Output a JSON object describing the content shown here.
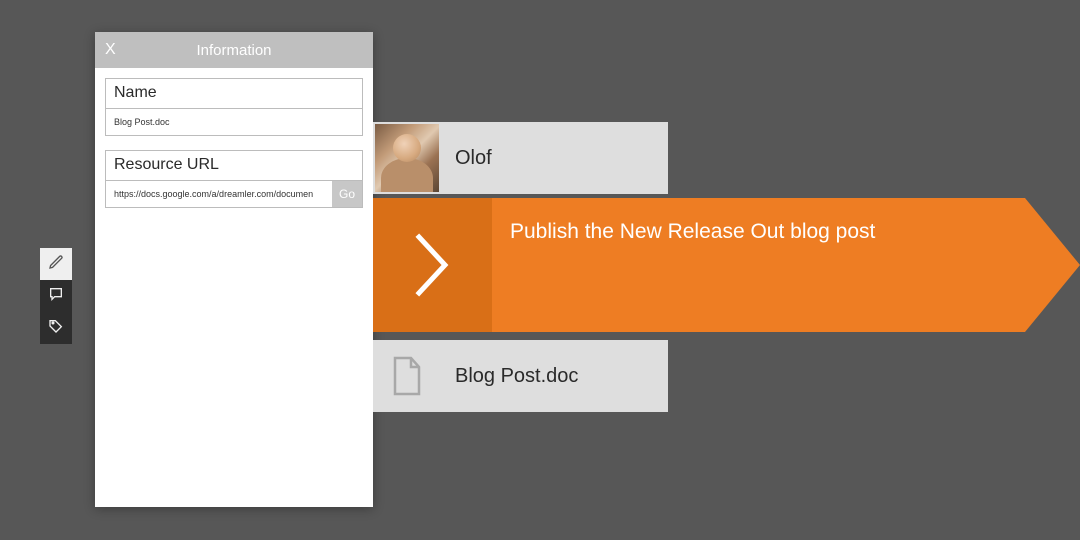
{
  "toolstrip": {
    "edit_icon": "pencil-icon",
    "comment_icon": "comment-icon",
    "tag_icon": "tag-icon"
  },
  "info_panel": {
    "close_label": "X",
    "title": "Information",
    "name": {
      "label": "Name",
      "value": "Blog Post.doc"
    },
    "resource_url": {
      "label": "Resource URL",
      "value": "https://docs.google.com/a/dreamler.com/documen",
      "go_label": "Go"
    }
  },
  "user_card": {
    "name": "Olof"
  },
  "task": {
    "title": "Publish the New Release Out blog post"
  },
  "file_card": {
    "name": "Blog Post.doc"
  },
  "colors": {
    "accent": "#ee7d23",
    "accent_dark": "#d96f17",
    "panel_header": "#bfbfbf",
    "bg": "#575757"
  }
}
